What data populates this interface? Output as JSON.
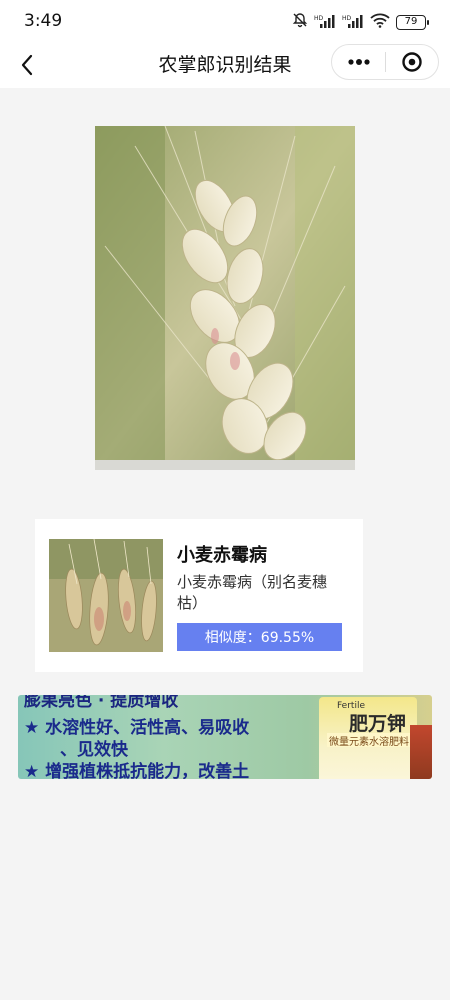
{
  "status_bar": {
    "time": "3:49",
    "battery": "79"
  },
  "nav": {
    "title": "农掌郎识别结果"
  },
  "result": {
    "name": "小麦赤霉病",
    "description": "小麦赤霉病（别名麦穗枯）",
    "similarity": "相似度：69.55%"
  },
  "ad": {
    "lines": [
      "膨果亮色 · 提质增收",
      "★ 水溶性好、活性高、易吸收",
      "、见效快",
      "★ 增强植株抵抗能力，改善土"
    ],
    "product_brand_small": "Fertile",
    "product_brand": "肥万钾",
    "product_desc": "微量元素水溶肥料"
  },
  "colors": {
    "accent": "#6680f0",
    "background": "#f4f4f4",
    "ad_text": "#1a2a8c"
  }
}
